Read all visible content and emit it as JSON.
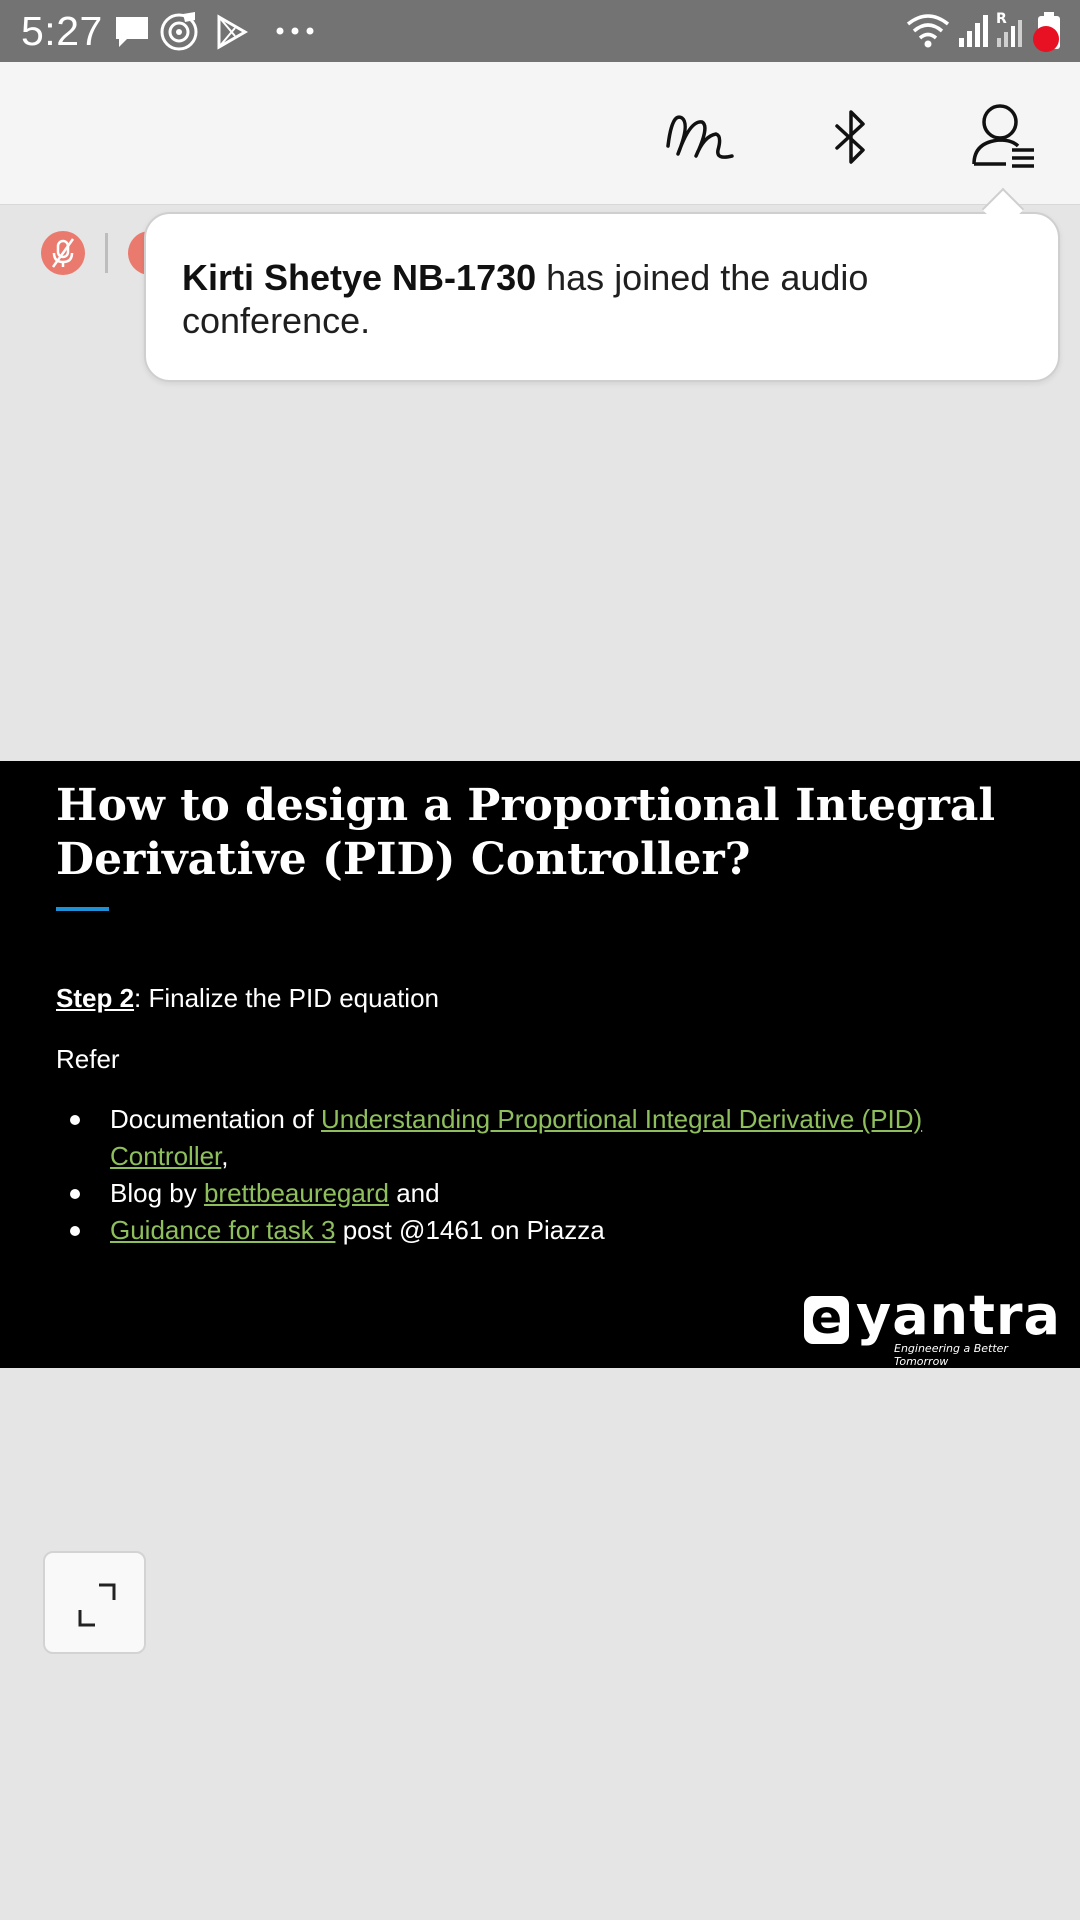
{
  "status_bar": {
    "time": "5:27",
    "left_icons": [
      "message-icon",
      "music-icon",
      "play-store-icon",
      "more-icon"
    ],
    "right_icons": [
      "wifi-icon",
      "signal-icon",
      "signal-roaming-icon",
      "battery-icon"
    ],
    "roaming_label": "R"
  },
  "header": {
    "icons": [
      "ink-icon",
      "bluetooth-icon",
      "participants-icon"
    ],
    "notification_color": "#e81123"
  },
  "toolbar": {
    "badge_color": "#ea7a6e"
  },
  "toast": {
    "name": "Kirti Shetye NB-1730",
    "message": " has joined the audio conference."
  },
  "slide": {
    "title": "How to design a Proportional Integral Derivative (PID) Controller?",
    "step_label": "Step 2",
    "step_text": ": Finalize the PID equation",
    "refer": "Refer",
    "bullets": [
      {
        "prefix": "Documentation of ",
        "link": "Understanding Proportional Integral Derivative (PID) Controller",
        "suffix": ","
      },
      {
        "prefix": "Blog by ",
        "link": "brettbeauregard",
        "suffix": " and"
      },
      {
        "prefix": "",
        "link": "Guidance for task 3",
        "suffix": " post @1461 on Piazza"
      }
    ],
    "link_color": "#8fbf5c",
    "accent_color": "#1e90d6",
    "brand": {
      "letter": "e",
      "name": "yantra",
      "tagline": "Engineering a Better Tomorrow"
    }
  },
  "fullscreen": {
    "icon": "expand-icon"
  }
}
